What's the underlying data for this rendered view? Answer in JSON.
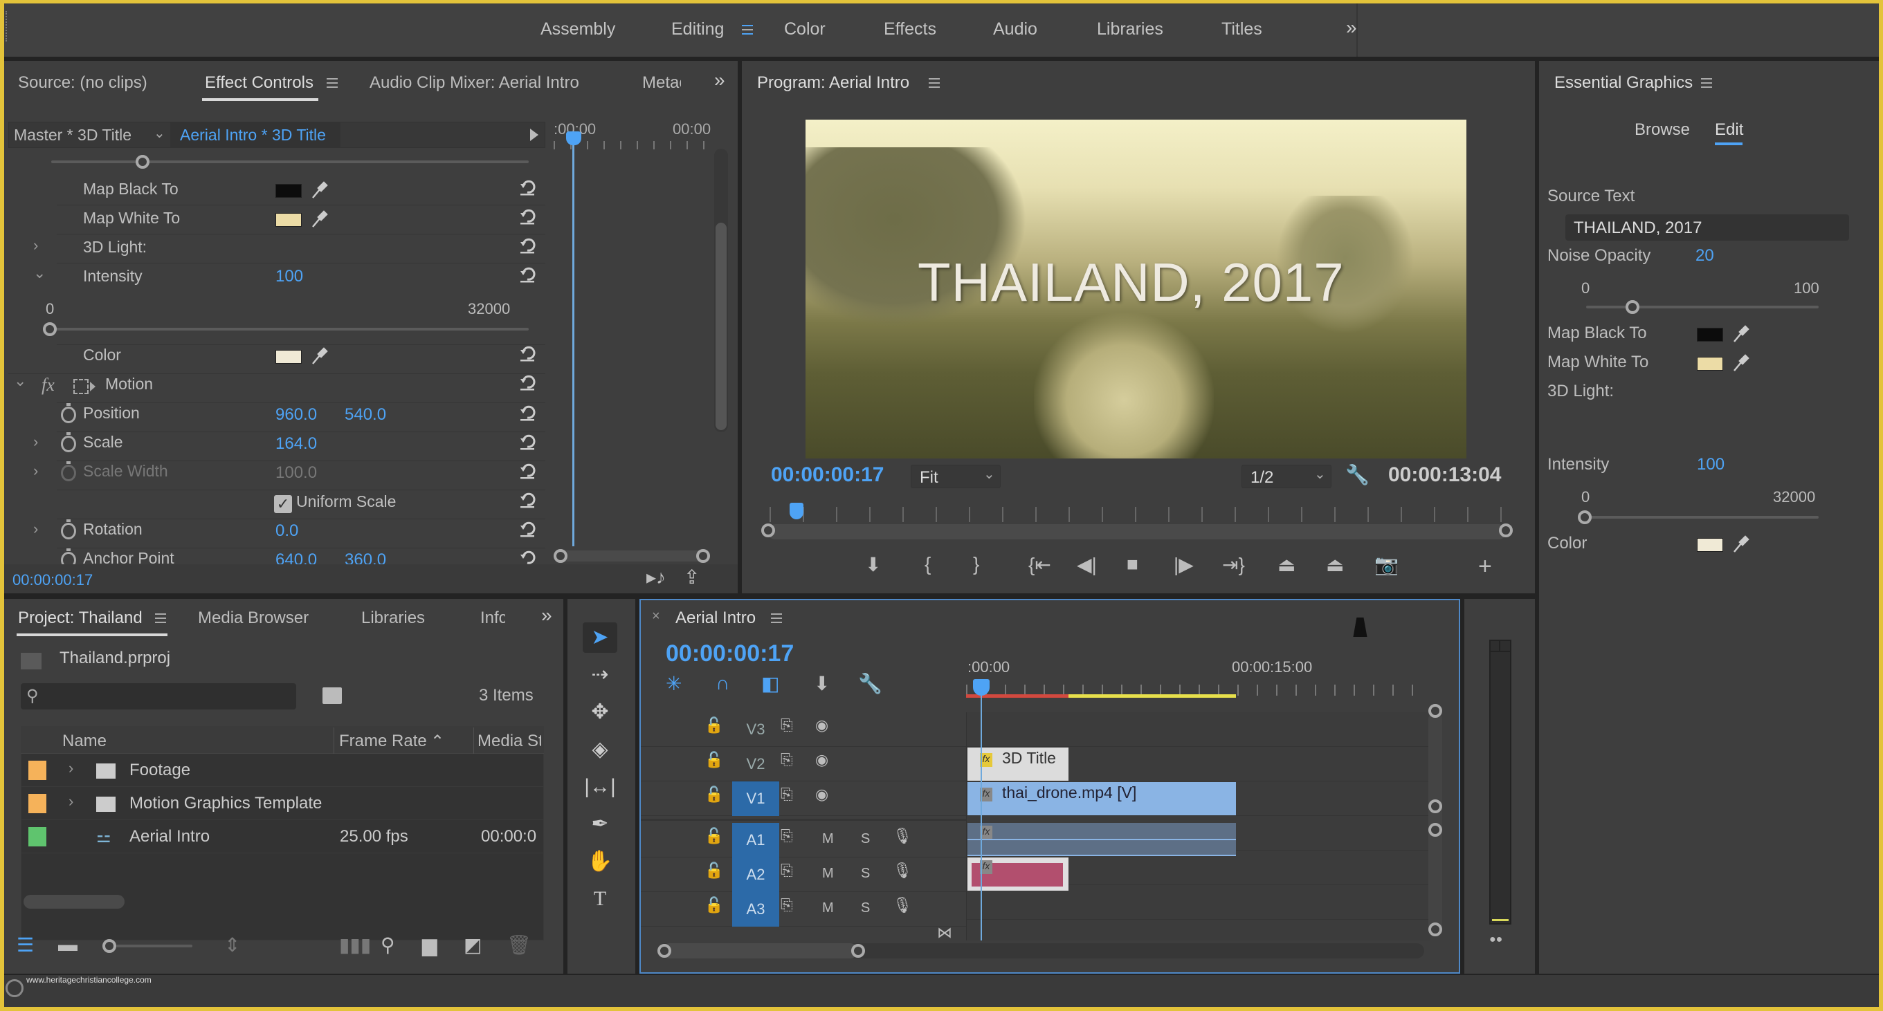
{
  "workspaces": {
    "tabs": [
      {
        "label": "Assembly",
        "active": false
      },
      {
        "label": "Editing",
        "active": true
      },
      {
        "label": "Color",
        "active": false
      },
      {
        "label": "Effects",
        "active": false
      },
      {
        "label": "Audio",
        "active": false
      },
      {
        "label": "Libraries",
        "active": false
      },
      {
        "label": "Titles",
        "active": false
      }
    ],
    "overflow_icon": "double-chevron-right-icon"
  },
  "source_panel": {
    "tabs": [
      {
        "label": "Source: (no clips)",
        "active": false
      },
      {
        "label": "Effect Controls",
        "active": true
      },
      {
        "label": "Audio Clip Mixer: Aerial Intro",
        "active": false
      },
      {
        "label": "Metac",
        "active": false
      }
    ],
    "master_label": "Master * 3D Title",
    "clip_label": "Aerial Intro * 3D Title",
    "mini_timeline": {
      "start": ":00:00",
      "end": "00:00"
    },
    "properties": {
      "map_black_to": {
        "label": "Map Black To",
        "color": "#0c0c0c"
      },
      "map_white_to": {
        "label": "Map White To",
        "color": "#ecdca6"
      },
      "light_3d": {
        "label": "3D Light:"
      },
      "intensity": {
        "label": "Intensity",
        "value": "100",
        "min": "0",
        "max": "32000",
        "fraction": 0.003
      },
      "color": {
        "label": "Color",
        "color": "#f0ead6"
      },
      "motion": {
        "label": "Motion",
        "fx": "fx"
      },
      "position": {
        "label": "Position",
        "x": "960.0",
        "y": "540.0"
      },
      "scale": {
        "label": "Scale",
        "value": "164.0"
      },
      "scale_width": {
        "label": "Scale Width",
        "value": "100.0"
      },
      "uniform_scale": {
        "label": "Uniform Scale",
        "checked": true
      },
      "rotation": {
        "label": "Rotation",
        "value": "0.0"
      },
      "anchor_point": {
        "label": "Anchor Point",
        "x": "640.0",
        "y": "360.0"
      }
    },
    "timecode": "00:00:00:17"
  },
  "program_monitor": {
    "title": "Program: Aerial Intro",
    "overlay_title": "THAILAND, 2017",
    "timecode": "00:00:00:17",
    "zoom": "Fit",
    "resolution": "1/2",
    "duration": "00:00:13:04",
    "playhead_fraction": 0.04,
    "controls": [
      "marker-icon",
      "mark-in-icon",
      "mark-out-icon",
      "go-to-in-icon",
      "step-back-icon",
      "stop-icon",
      "step-forward-icon",
      "go-to-out-icon",
      "lift-icon",
      "extract-icon",
      "export-frame-icon",
      "add-button-icon"
    ]
  },
  "essential_graphics": {
    "title": "Essential Graphics",
    "tabs": [
      {
        "label": "Browse",
        "active": false
      },
      {
        "label": "Edit",
        "active": true
      }
    ],
    "source_text_label": "Source Text",
    "source_text_value": "THAILAND, 2017",
    "noise_opacity": {
      "label": "Noise Opacity",
      "value": "20",
      "min": "0",
      "max": "100",
      "fraction": 0.2
    },
    "map_black_to": {
      "label": "Map Black To",
      "color": "#0c0c0c"
    },
    "map_white_to": {
      "label": "Map White To",
      "color": "#ecdca6"
    },
    "light_3d": {
      "label": "3D Light:"
    },
    "intensity": {
      "label": "Intensity",
      "value": "100",
      "min": "0",
      "max": "32000",
      "fraction": 0.003
    },
    "color": {
      "label": "Color",
      "color": "#f0ead6"
    }
  },
  "project_panel": {
    "tabs": [
      {
        "label": "Project: Thailand",
        "active": true
      },
      {
        "label": "Media Browser",
        "active": false
      },
      {
        "label": "Libraries",
        "active": false
      },
      {
        "label": "Infc",
        "active": false
      }
    ],
    "project_file": "Thailand.prproj",
    "search_placeholder": "",
    "item_count": "3 Items",
    "columns": [
      "Name",
      "Frame Rate",
      "Media St"
    ],
    "items": [
      {
        "name": "Footage",
        "type": "folder",
        "label_color": "#f5b25a",
        "frame_rate": "",
        "media_start": ""
      },
      {
        "name": "Motion Graphics Template",
        "type": "folder",
        "label_color": "#f5b25a",
        "frame_rate": "",
        "media_start": ""
      },
      {
        "name": "Aerial Intro",
        "type": "sequence",
        "label_color": "#5fc46e",
        "frame_rate": "25.00 fps",
        "media_start": "00:00:0"
      }
    ]
  },
  "tools": [
    "selection-tool-icon",
    "track-select-tool-icon",
    "ripple-edit-tool-icon",
    "razor-tool-icon",
    "slip-tool-icon",
    "pen-tool-icon",
    "hand-tool-icon",
    "type-tool-icon"
  ],
  "timeline": {
    "title": "Aerial Intro",
    "timecode": "00:00:00:17",
    "ruler": {
      "start": ":00:00",
      "mid": "00:00:15:00"
    },
    "tracks": {
      "video": [
        {
          "name": "V3",
          "targeted": false
        },
        {
          "name": "V2",
          "targeted": false
        },
        {
          "name": "V1",
          "targeted": true
        }
      ],
      "audio": [
        {
          "name": "A1",
          "targeted": true,
          "m": "M",
          "s": "S"
        },
        {
          "name": "A2",
          "targeted": true,
          "m": "M",
          "s": "S"
        },
        {
          "name": "A3",
          "targeted": true,
          "m": "M",
          "s": "S"
        }
      ]
    },
    "clips": [
      {
        "name": "3D Title",
        "track": "V2"
      },
      {
        "name": "thai_drone.mp4 [V]",
        "track": "V1"
      },
      {
        "name": "",
        "track": "A1"
      },
      {
        "name": "",
        "track": "A2"
      }
    ]
  },
  "status_bar": {
    "watermark": "www.heritagechristiancollege.com"
  }
}
